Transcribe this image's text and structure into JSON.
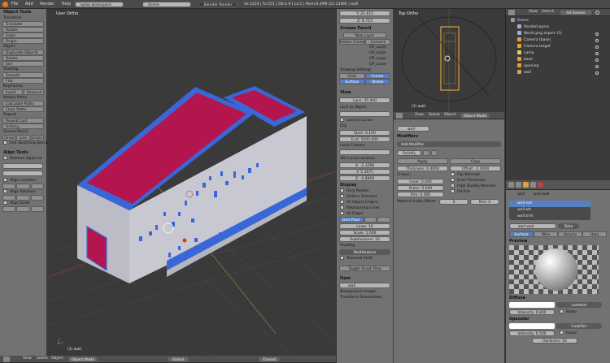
{
  "topbar": {
    "menus": [
      "File",
      "Add",
      "Render",
      "Help"
    ],
    "workspace": "spine.workspace",
    "scene": "Scene",
    "engine": "Blender Render",
    "stats": "Ve:1224 | Fa:551 | Ob:1-9 | La:1 | Mem:6.49M (12.234M) | wall"
  },
  "toolshelf": {
    "title": "Object Tools",
    "sections": [
      {
        "head": "Transform",
        "buttons": [
          "Translate",
          "Rotate",
          "Scale",
          "Origin"
        ]
      },
      {
        "head": "Object",
        "buttons": [
          "Duplicate Objects",
          "Delete",
          "Join"
        ]
      },
      {
        "head": "Shading",
        "buttons": [
          "Smooth",
          "Flat"
        ]
      },
      {
        "head": "Keyframes",
        "buttons": [
          "Insert",
          "Remove"
        ]
      },
      {
        "head": "Motion Paths",
        "buttons": [
          "Calculate Paths",
          "Clear Paths"
        ]
      },
      {
        "head": "Repeat",
        "buttons": [
          "Repeat Last",
          "History..."
        ]
      }
    ],
    "grease": {
      "head": "Grease Pencil",
      "buttons": [
        "Draw",
        "Line",
        "Erase"
      ],
      "check": "Use Sketching Sessions"
    },
    "align": {
      "head": "Align Tools",
      "items": [
        "Relative object to",
        "Align Location",
        "Align Rotation",
        "Align Scale"
      ]
    }
  },
  "viewport": {
    "label": "User Ortho",
    "object_label": "(1) wall",
    "bottom": [
      "View",
      "Select",
      "Object",
      "Object Mode",
      "Global",
      "Closest"
    ]
  },
  "npanel": {
    "loc_values": [
      "Y: 21.615",
      "Z: 6.715"
    ],
    "grease_head": "Grease Pencil",
    "grease_buttons": [
      "New Layer",
      "Delete Frame",
      "Convert"
    ],
    "layers": [
      "GP_Layer",
      "GP_Layer",
      "GP_Layer",
      "GP_Layer"
    ],
    "drawing_head": "Drawing Settings",
    "drawing_view": [
      "View",
      "Cursor"
    ],
    "drawing_surface": [
      "Surface",
      "Stroke"
    ],
    "view_head": "View",
    "lens": "Lens: 35.000",
    "lock_head": "Lock to Object",
    "lock_cursor": "Lock to Cursor",
    "clip_head": "Clip",
    "clip_start": "Start: 0.100",
    "clip_end": "End: 5000.000",
    "local_cam": "Local Camera",
    "cursor_head": "3D Cursor Location",
    "cursor": [
      "X: -2.3296",
      "Y: 5.3671",
      "Z: -0.8809"
    ],
    "display_head": "Display",
    "display_items": [
      "Only Render",
      "Outline Selected",
      "All Object Origins",
      "Relationship Lines",
      "All Edges"
    ],
    "gridfloor": "Grid Floor",
    "grid_vals": [
      "Lines: 16",
      "Scale: 1.000",
      "Subdivisions: 10"
    ],
    "shading_head": "Shading",
    "shading_mode": "Multitexture",
    "textured_solid": "Textured Solid",
    "quad_view": "Toggle Quad View",
    "item_head": "Item",
    "item_name": "wall",
    "bg_images": "Background Images",
    "transform_orient": "Transform Orientations"
  },
  "topview": {
    "label": "Top Ortho",
    "object_label": "(1) wall",
    "bottom": [
      "View",
      "Select",
      "Object",
      "Object Mode"
    ]
  },
  "modifiers": {
    "object_name": "wall",
    "head": "Modifiers",
    "add": "Add Modifier",
    "name": "Solidify",
    "apply": "Apply",
    "copy": "Copy",
    "thickness": "Thickness: 0.4000",
    "offset": "Offset: -1.0000",
    "crease_head": "Crease:",
    "inner": "Inner: 0.000",
    "outer": "Outer: 0.000",
    "rim": "Rim: 0.000",
    "checks": [
      "Flip Normals",
      "Even Thickness",
      "High Quality Normals",
      "Fill Rim",
      "Only Rim"
    ],
    "mat_offset": "Material Index Offset:",
    "mat_val": "0",
    "rim_val": "Rim: 0"
  },
  "outliner": {
    "menus": [
      "View",
      "Search",
      "All Scenes"
    ],
    "rows": [
      "Scene",
      "RenderLayers",
      "World.png export (5)",
      "Camera (base)",
      "Camera target",
      "Lamp",
      "base",
      "opening",
      "wall"
    ]
  },
  "material": {
    "object_name": "wall",
    "mesh_name": "wall.wall",
    "slots": [
      "wall.red",
      "wall.wlt",
      "wall.trim"
    ],
    "mat_name": "wall.wall",
    "data_label": "Data",
    "tabs": [
      "Surface",
      "Wire",
      "Volume",
      "Halo"
    ],
    "preview_head": "Preview",
    "diffuse_head": "Diffuse",
    "diffuse_shader": "Lambert",
    "diffuse_intensity": "Intensity: 0.800",
    "ramp": "Ramp",
    "specular_head": "Specular",
    "spec_shader": "CookTorr",
    "spec_intensity": "Intensity: 0.500",
    "hardness": "Hardness: 50"
  }
}
